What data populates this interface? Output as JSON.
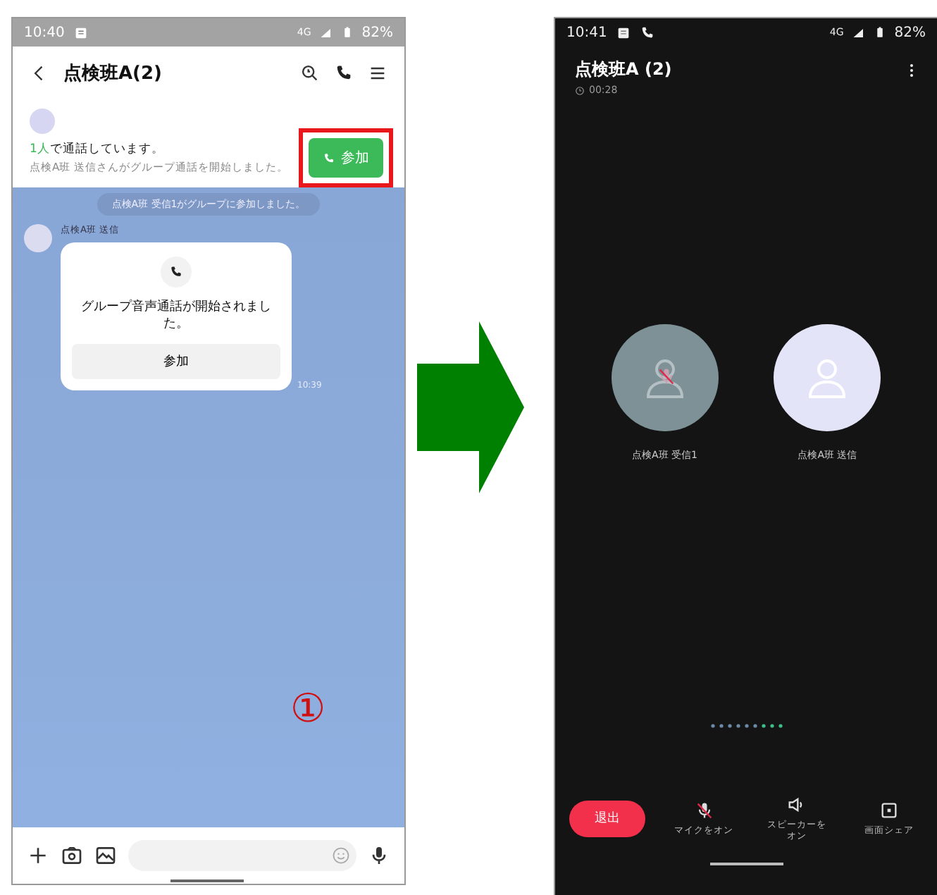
{
  "chat_screen": {
    "status_bar": {
      "time": "10:40",
      "network": "4G",
      "battery": "82%"
    },
    "title": "点検班A(2)",
    "call_banner": {
      "count": "1人",
      "text": "で通話しています。",
      "detail": "点検A班 送信さんがグループ通話を開始しました。",
      "join_button": "参加",
      "highlighted": true
    },
    "system_message": "点検A班 受信1がグループに参加しました。",
    "message": {
      "sender": "点検A班 送信",
      "text": "グループ音声通話が開始されました。",
      "button": "参加",
      "time": "10:39"
    },
    "step_marker": "①"
  },
  "call_screen": {
    "status_bar": {
      "time": "10:41",
      "network": "4G",
      "battery": "82%"
    },
    "title": "点検班A (2)",
    "duration": "00:28",
    "participants": [
      {
        "name": "点検A班 受信1",
        "muted": true
      },
      {
        "name": "点検A班 送信",
        "muted": false
      }
    ],
    "leave_button": "退出",
    "controls": [
      {
        "kind": "mic",
        "label": "マイクをオン"
      },
      {
        "kind": "speaker",
        "label": "スピーカーをオン"
      },
      {
        "kind": "share",
        "label": "画面シェア"
      }
    ]
  }
}
